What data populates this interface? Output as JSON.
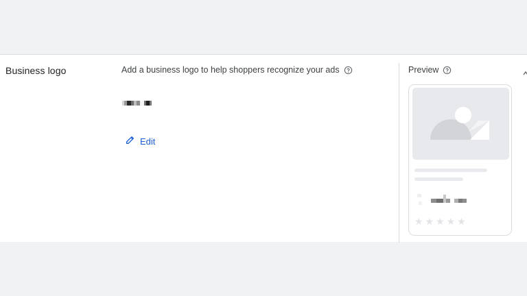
{
  "section": {
    "title": "Business logo"
  },
  "description": {
    "text": "Add a business logo to help shoppers recognize your ads",
    "help_icon": "help-circle-icon"
  },
  "logo_value": {
    "icon": "blurred-logo-text"
  },
  "edit": {
    "label": "Edit",
    "icon": "pencil-icon"
  },
  "preview": {
    "title": "Preview",
    "help_icon": "help-circle-icon",
    "collapse_icon": "chevron-up-icon",
    "rating_stars": 5
  },
  "colors": {
    "background": "#f1f2f4",
    "card": "#ffffff",
    "link": "#1a5fd6",
    "text": "#202124",
    "placeholder": "#e8e9ec"
  }
}
